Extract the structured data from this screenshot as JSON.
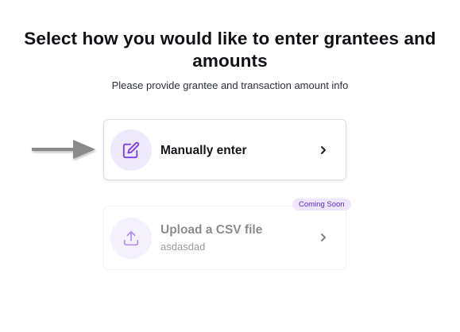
{
  "header": {
    "title": "Select how you would like to enter grantees and amounts",
    "subtitle": "Please provide grantee and transaction amount info"
  },
  "options": [
    {
      "label": "Manually enter",
      "icon": "edit-icon",
      "enabled": true
    },
    {
      "label": "Upload a CSV file",
      "sublabel": "asdasdad",
      "icon": "upload-icon",
      "badge": "Coming Soon",
      "enabled": false
    }
  ],
  "annotation": {
    "icon": "pointer-arrow-icon"
  },
  "colors": {
    "accent": "#7b3fe4",
    "icon_bg": "#efe9fc",
    "badge_bg": "#efe6fd",
    "badge_text": "#5b2bbf",
    "arrow": "#8a8a8a"
  }
}
